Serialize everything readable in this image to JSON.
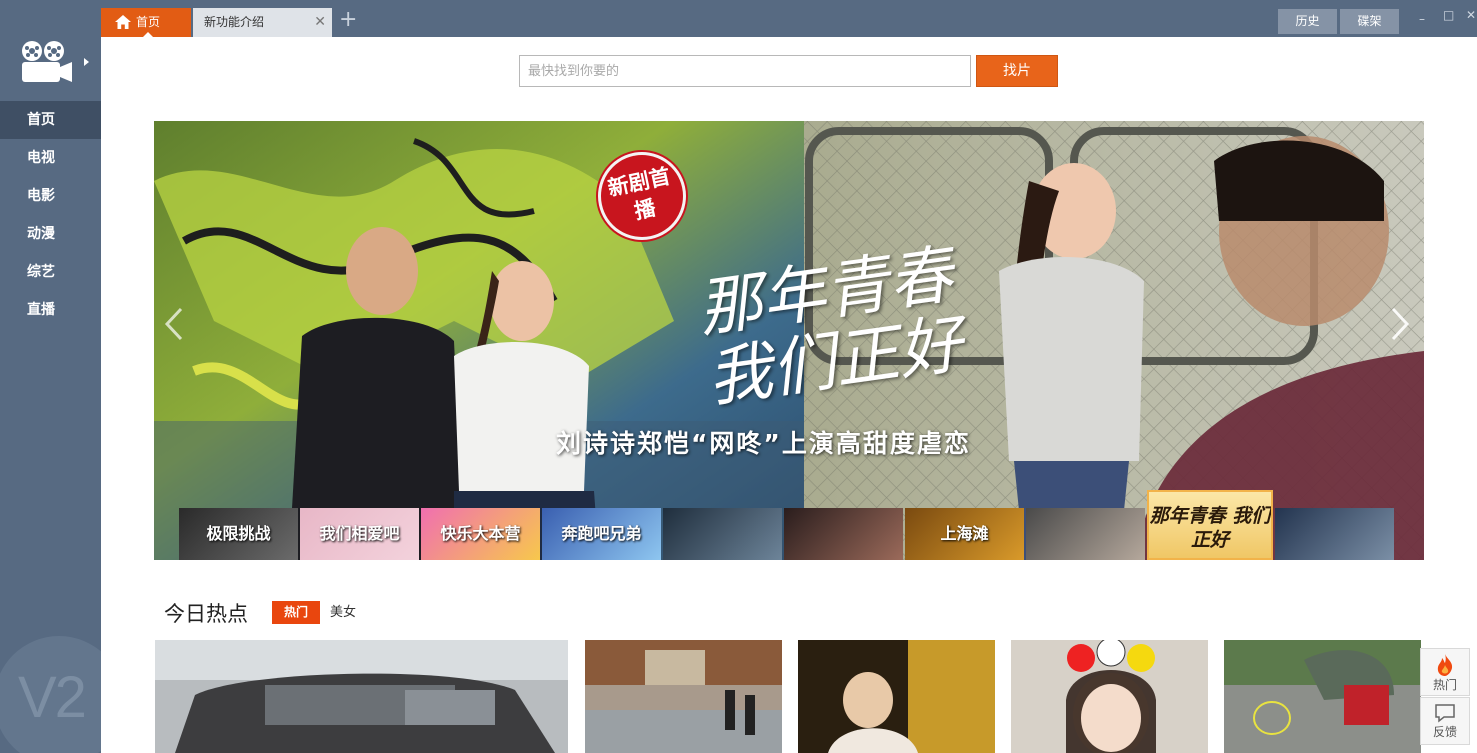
{
  "colors": {
    "sidebar": "#576a82",
    "accent": "#e25c14",
    "hot_tag": "#e9460e"
  },
  "sidebar": {
    "logo_icon": "film-camera-icon",
    "nav": [
      {
        "label": "首页",
        "active": true
      },
      {
        "label": "电视"
      },
      {
        "label": "电影"
      },
      {
        "label": "动漫"
      },
      {
        "label": "综艺"
      },
      {
        "label": "直播"
      }
    ],
    "version_watermark": "V2"
  },
  "tabs": [
    {
      "label": "首页",
      "icon": "home-icon",
      "active": true
    },
    {
      "label": "新功能介绍",
      "close_icon": "close-icon"
    }
  ],
  "tab_add": "+",
  "toolbar": {
    "history_label": "历史",
    "disc_label": "碟架"
  },
  "window_controls": {
    "minimize": "–",
    "maximize": "□",
    "close": "✕"
  },
  "search": {
    "placeholder": "最快找到你要的",
    "value": "",
    "button_label": "找片"
  },
  "banner": {
    "badge": "新剧首播",
    "title": "那年青春 我们正好",
    "subtitle": "刘诗诗郑恺“网咚”上演高甜度虐恋",
    "thumbnails": [
      {
        "label": "极限挑战"
      },
      {
        "label": "我们相爱吧"
      },
      {
        "label": "快乐大本营"
      },
      {
        "label": "奔跑吧兄弟"
      },
      {
        "label": ""
      },
      {
        "label": ""
      },
      {
        "label": "上海滩"
      },
      {
        "label": ""
      },
      {
        "label": "那年青春 我们正好",
        "active": true
      },
      {
        "label": ""
      }
    ]
  },
  "hot": {
    "title": "今日热点",
    "tabs": [
      {
        "label": "热门",
        "active": true
      },
      {
        "label": "美女"
      }
    ]
  },
  "floating": {
    "hot_label": "热门",
    "hot_icon": "flame-icon",
    "feedback_label": "反馈",
    "feedback_icon": "speech-bubble-icon"
  }
}
